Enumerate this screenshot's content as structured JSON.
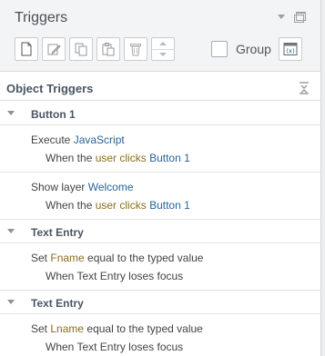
{
  "panel": {
    "title": "Triggers",
    "group_label": "Group"
  },
  "toolbar": {
    "icons": [
      "new-trigger-icon",
      "edit-icon",
      "copy-icon",
      "paste-icon",
      "delete-icon",
      "reorder-stepper",
      "variables-icon"
    ]
  },
  "section": {
    "title": "Object Triggers"
  },
  "objects": [
    {
      "name": "Button 1",
      "triggers": [
        {
          "l1_pre": "Execute ",
          "l1_link": "JavaScript",
          "l2_pre": "When the ",
          "l2_var": "user clicks",
          "l2_sp": " ",
          "l2_link": "Button 1"
        },
        {
          "l1_pre": "Show layer ",
          "l1_link": "Welcome",
          "l2_pre": "When the ",
          "l2_var": "user clicks",
          "l2_sp": " ",
          "l2_link": "Button 1"
        }
      ]
    },
    {
      "name": "Text Entry",
      "triggers": [
        {
          "l1_pre": "Set ",
          "l1_var": "Fname",
          "l1_post": " equal to the typed value",
          "l2_text": "When Text Entry loses focus"
        }
      ]
    },
    {
      "name": "Text Entry",
      "triggers": [
        {
          "l1_pre": "Set ",
          "l1_var": "Lname",
          "l1_post": " equal to the typed value",
          "l2_text": "When Text Entry loses focus"
        }
      ]
    }
  ],
  "colors": {
    "link": "#2a6496",
    "variable": "#8a6d1c",
    "header_bg": "#f3f4f6"
  }
}
